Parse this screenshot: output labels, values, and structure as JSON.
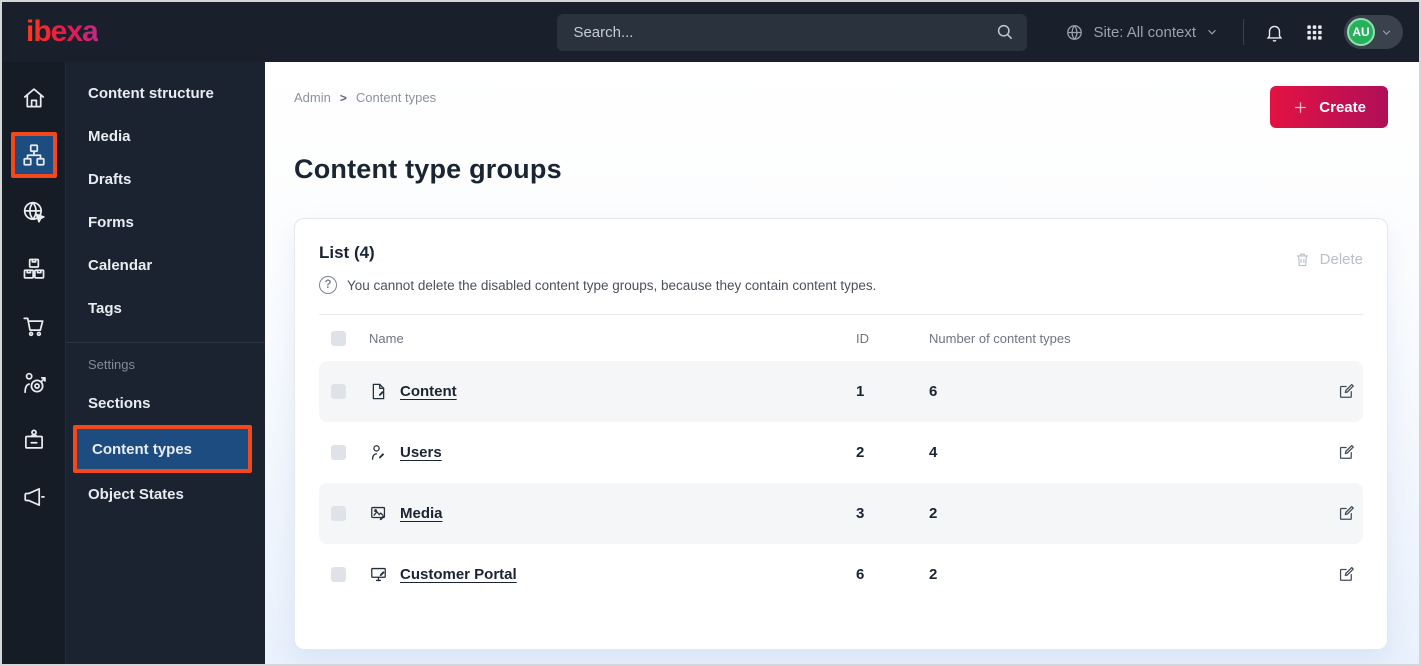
{
  "topbar": {
    "logo_text": "ibexa",
    "search": {
      "placeholder": "Search..."
    },
    "site_context_label": "Site: All context",
    "avatar_initials": "AU"
  },
  "nav_rail": {
    "items": [
      {
        "name": "dashboard",
        "icon": "home",
        "active": false
      },
      {
        "name": "content",
        "icon": "sitemap",
        "active": true
      },
      {
        "name": "site",
        "icon": "globe-pointer",
        "active": false
      },
      {
        "name": "product-catalog",
        "icon": "boxes",
        "active": false
      },
      {
        "name": "commerce",
        "icon": "cart",
        "active": false
      },
      {
        "name": "personalization",
        "icon": "person-target",
        "active": false
      },
      {
        "name": "admin",
        "icon": "id-badge",
        "active": false
      },
      {
        "name": "marketing",
        "icon": "megaphone",
        "active": false
      }
    ]
  },
  "sidebar": {
    "items": [
      "Content structure",
      "Media",
      "Drafts",
      "Forms",
      "Calendar",
      "Tags"
    ],
    "settings_label": "Settings",
    "settings_items": [
      "Sections",
      "Content types",
      "Object States"
    ],
    "active_item": "Content types"
  },
  "breadcrumb": {
    "items": [
      "Admin",
      "Content types"
    ],
    "separator": ">"
  },
  "page": {
    "title": "Content type groups",
    "create_label": "Create"
  },
  "list_card": {
    "title": "List (4)",
    "help_glyph": "?",
    "info_text": "You cannot delete the disabled content type groups, because they contain content types.",
    "delete_label": "Delete",
    "table": {
      "columns": [
        "Name",
        "ID",
        "Number of content types"
      ],
      "rows": [
        {
          "name": "Content",
          "icon": "file-edit",
          "id": "1",
          "count": "6"
        },
        {
          "name": "Users",
          "icon": "user-edit",
          "id": "2",
          "count": "4"
        },
        {
          "name": "Media",
          "icon": "image-edit",
          "id": "3",
          "count": "2"
        },
        {
          "name": "Customer Portal",
          "icon": "monitor-edit",
          "id": "6",
          "count": "2"
        }
      ]
    }
  },
  "colors": {
    "topbar_bg": "#19202b",
    "active_nav_bg": "#1d4d80",
    "annotation_orange": "#f2481b",
    "create_gradient_start": "#e31243",
    "create_gradient_end": "#b00f58",
    "avatar_green": "#27b05c",
    "row_alt_bg": "#f5f6f8"
  }
}
